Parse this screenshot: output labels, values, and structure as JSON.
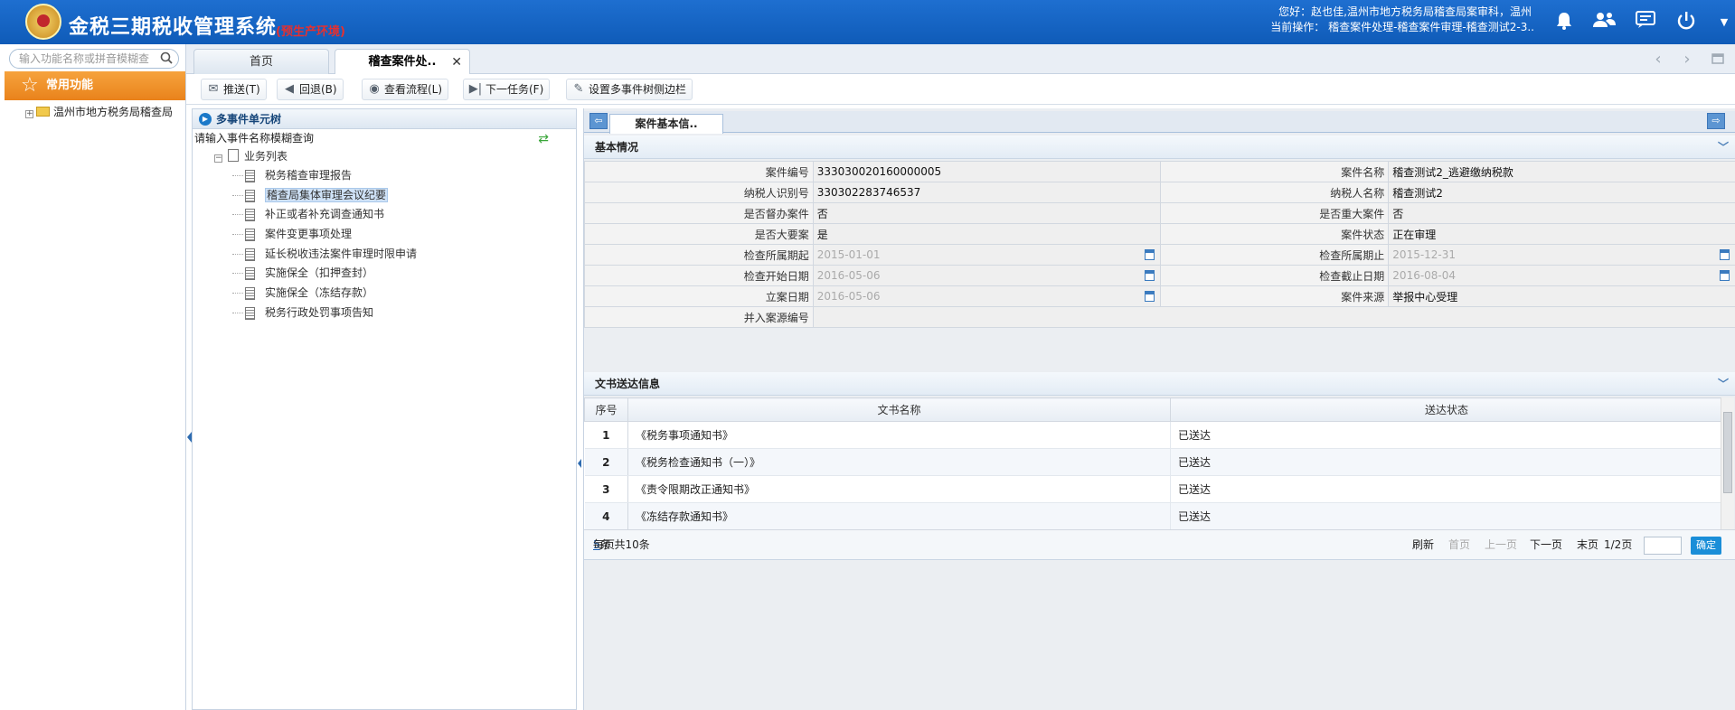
{
  "header": {
    "title": "金税三期税收管理系统",
    "env": "(预生产环境)",
    "user_line": "您好：赵也佳,温州市地方税务局稽查局案审科，温州",
    "current_op": "当前操作： 稽查案件处理-稽查案件审理-稽查测试2-3.."
  },
  "sidebar": {
    "search_placeholder": "输入功能名称或拼音模糊查",
    "favorites_label": "常用功能",
    "org_node": "温州市地方税务局稽查局"
  },
  "tabs": {
    "home": "首页",
    "active": "稽查案件处.."
  },
  "toolbar": {
    "push": "推送(T)",
    "back": "回退(B)",
    "view_flow": "查看流程(L)",
    "next_task": "下一任务(F)",
    "sidebar_setting": "设置多事件树侧边栏"
  },
  "tree": {
    "header": "多事件单元树",
    "search_hint": "请输入事件名称模糊查询",
    "root": "业务列表",
    "items": [
      "税务稽查审理报告",
      "稽查局集体审理会议纪要",
      "补正或者补充调查通知书",
      "案件变更事项处理",
      "延长税收违法案件审理时限申请",
      "实施保全（扣押查封）",
      "实施保全（冻结存款）",
      "税务行政处罚事项告知"
    ]
  },
  "detail": {
    "tab": "案件基本信..",
    "basic_section": "基本情况",
    "fields": {
      "case_no_label": "案件编号",
      "case_no": "333030020160000005",
      "case_name_label": "案件名称",
      "case_name": "稽查测试2_逃避缴纳税款",
      "taxpayer_id_label": "纳税人识别号",
      "taxpayer_id": "330302283746537",
      "taxpayer_name_label": "纳税人名称",
      "taxpayer_name": "稽查测试2",
      "supervised_label": "是否督办案件",
      "supervised": "否",
      "major_label": "是否重大案件",
      "major": "否",
      "key_label": "是否大要案",
      "key": "是",
      "status_label": "案件状态",
      "status": "正在审理",
      "period_start_label": "检查所属期起",
      "period_start": "2015-01-01",
      "period_end_label": "检查所属期止",
      "period_end": "2015-12-31",
      "check_start_label": "检查开始日期",
      "check_start": "2016-05-06",
      "check_end_label": "检查截止日期",
      "check_end": "2016-08-04",
      "filing_date_label": "立案日期",
      "filing_date": "2016-05-06",
      "source_label": "案件来源",
      "source": "举报中心受理",
      "merged_label": "并入案源编号",
      "merged": ""
    },
    "doc_section": "文书送达信息",
    "doc_columns": [
      "序号",
      "文书名称",
      "送达状态"
    ],
    "docs": [
      {
        "no": "1",
        "name": "《税务事项通知书》",
        "status": "已送达"
      },
      {
        "no": "2",
        "name": "《税务检查通知书（一）》",
        "status": "已送达"
      },
      {
        "no": "3",
        "name": "《责令限期改正通知书》",
        "status": "已送达"
      },
      {
        "no": "4",
        "name": "《冻结存款通知书》",
        "status": "已送达"
      }
    ],
    "pager": {
      "per_page_prefix": "每页",
      "per_page": "5",
      "per_page_suffix": "条 共10条",
      "refresh": "刷新",
      "first": "首页",
      "prev": "上一页",
      "next": "下一页",
      "last": "末页",
      "page": "1/2页",
      "go": "确定"
    }
  },
  "colors": {
    "header_bg": "#1565c0",
    "favorites_bg": "#f08c22",
    "env_red": "#e53030",
    "accent_blue": "#1a8ed8"
  }
}
